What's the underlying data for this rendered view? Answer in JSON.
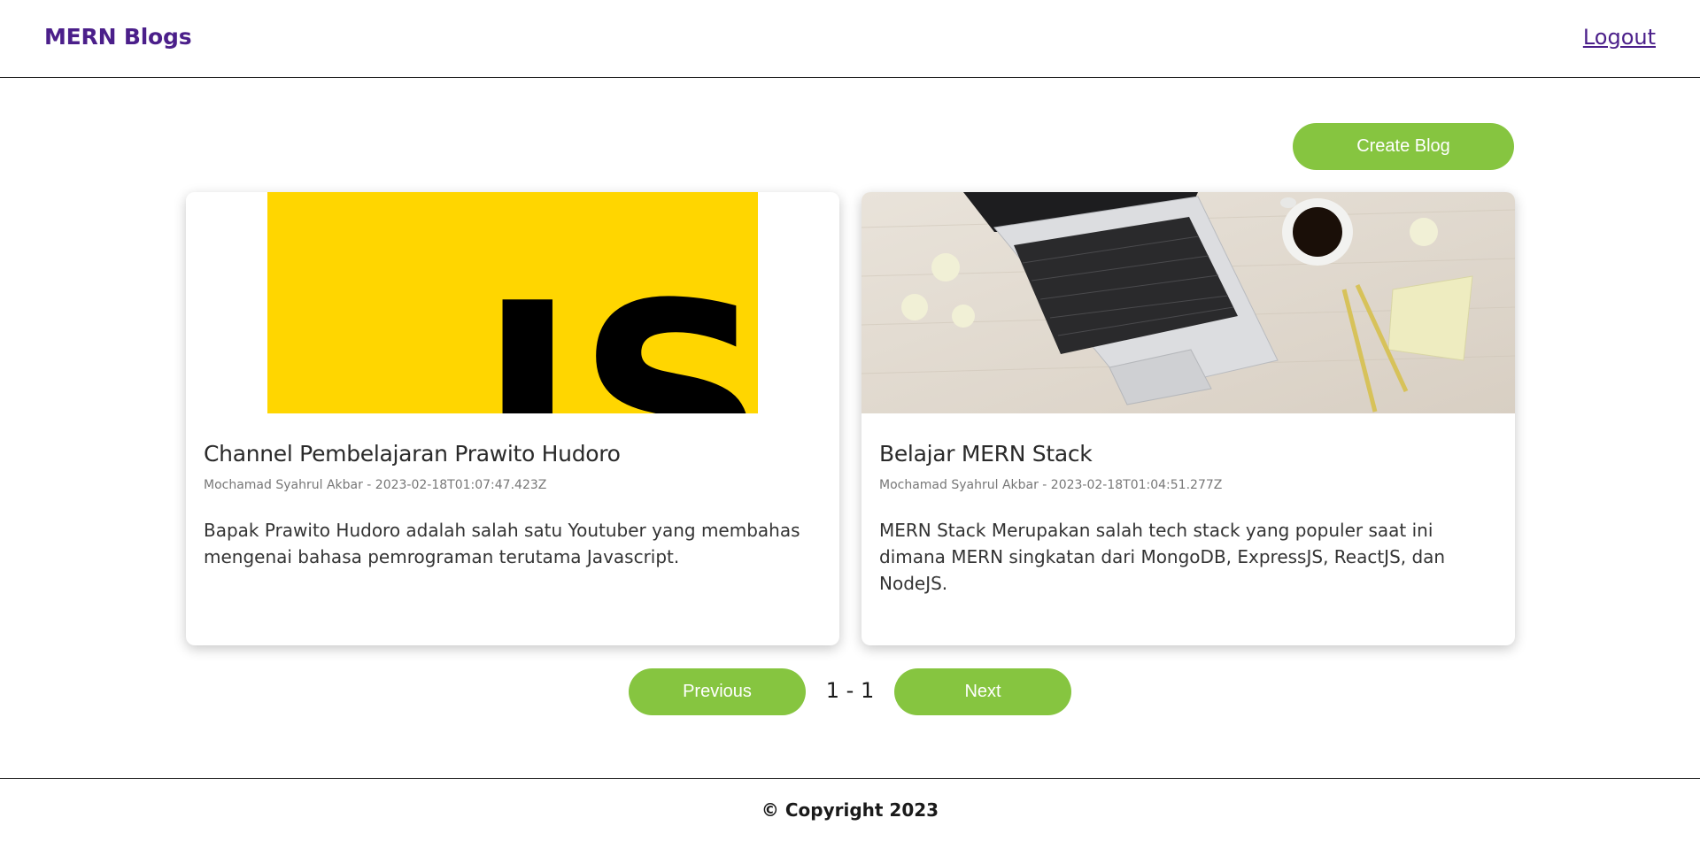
{
  "header": {
    "brand": "MERN Blogs",
    "logout_label": "Logout"
  },
  "toolbar": {
    "create_label": "Create Blog"
  },
  "posts": [
    {
      "title": "Channel Pembelajaran Prawito Hudoro",
      "meta": "Mochamad Syahrul Akbar - 2023-02-18T01:07:47.423Z",
      "body": "Bapak Prawito Hudoro adalah salah satu Youtuber yang membahas mengenai bahasa pemrograman terutama Javascript.",
      "image": "javascript-logo-image",
      "image_text": "JS"
    },
    {
      "title": "Belajar MERN Stack",
      "meta": "Mochamad Syahrul Akbar - 2023-02-18T01:04:51.277Z",
      "body": "MERN Stack Merupakan salah tech stack yang populer saat ini dimana MERN singkatan dari MongoDB, ExpressJS, ReactJS, dan NodeJS.",
      "image": "laptop-desk-photo"
    }
  ],
  "pagination": {
    "prev_label": "Previous",
    "indicator": "1 - 1",
    "next_label": "Next"
  },
  "footer": {
    "copyright": "© Copyright 2023"
  },
  "colors": {
    "brand": "#4b1f8a",
    "button": "#86c540",
    "js_yellow": "#ffd600"
  }
}
